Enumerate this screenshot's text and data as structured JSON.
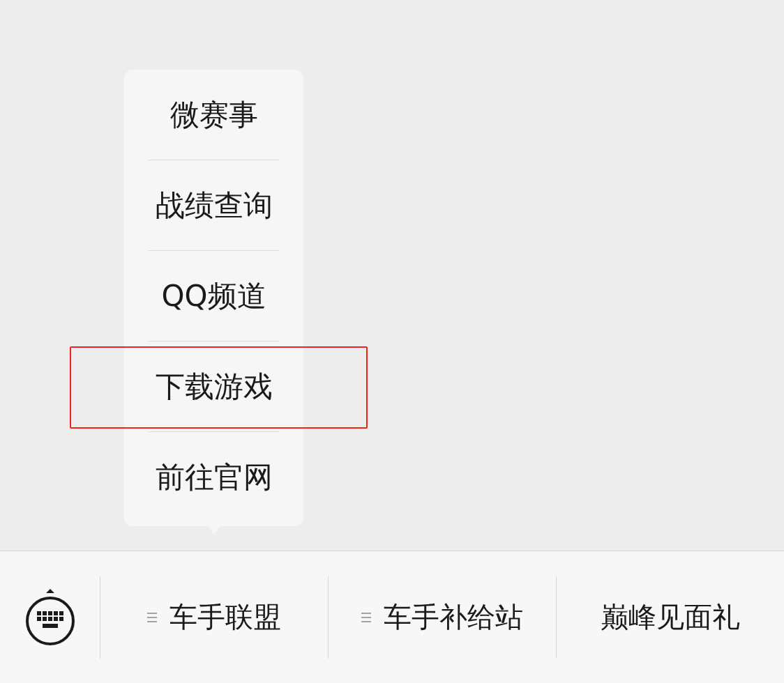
{
  "submenu": {
    "items": [
      {
        "label": "微赛事",
        "highlighted": false
      },
      {
        "label": "战绩查询",
        "highlighted": false
      },
      {
        "label": "QQ频道",
        "highlighted": false
      },
      {
        "label": "下载游戏",
        "highlighted": true
      },
      {
        "label": "前往官网",
        "highlighted": false
      }
    ]
  },
  "menu_bar": {
    "items": [
      {
        "label": "车手联盟",
        "has_submenu": true
      },
      {
        "label": "车手补给站",
        "has_submenu": true
      },
      {
        "label": "巅峰见面礼",
        "has_submenu": false
      }
    ]
  }
}
